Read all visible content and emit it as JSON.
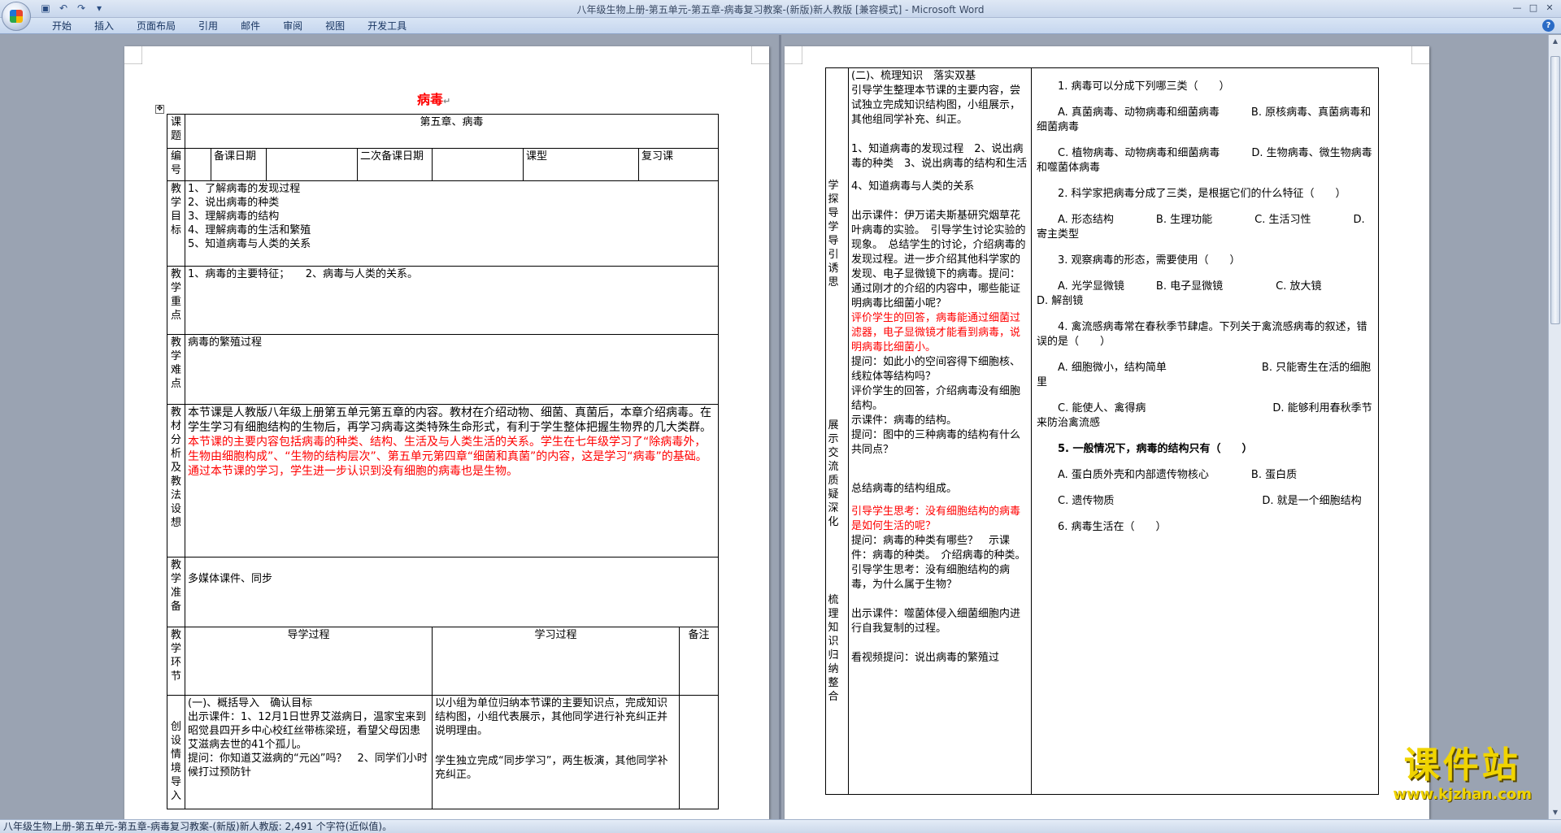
{
  "window": {
    "title": "八年级生物上册-第五单元-第五章-病毒复习教案-(新版)新人教版 [兼容模式] - Microsoft Word"
  },
  "ribbon": {
    "tabs": [
      "开始",
      "插入",
      "页面布局",
      "引用",
      "邮件",
      "审阅",
      "视图",
      "开发工具"
    ]
  },
  "status": {
    "text": "八年级生物上册-第五单元-第五章-病毒复习教案-(新版)新人教版: 2,491 个字符(近似值)。"
  },
  "page1": {
    "title": "病毒",
    "rows": {
      "topic_label": "课题",
      "topic_value": "第五章、病毒",
      "num_label": "编号",
      "prep_date_label": "备课日期",
      "second_prep_label": "二次备课日期",
      "class_type_label": "课型",
      "class_type_value": "复习课",
      "goals_label": "教学目标",
      "goals": [
        "1、了解病毒的发现过程",
        "2、说出病毒的种类",
        "3、理解病毒的结构",
        "4、理解病毒的生活和繁殖",
        "5、知道病毒与人类的关系"
      ],
      "focus_label": "教学重点",
      "focus_value": "1、病毒的主要特征；　　2、病毒与人类的关系。",
      "difficulty_label": "教学难点",
      "difficulty_value": "病毒的繁殖过程",
      "analysis_label": "教材分析及教法设想",
      "analysis_black": "本节课是人教版八年级上册第五单元第五章的内容。教材在介绍动物、细菌、真菌后，本章介绍病毒。在学生学习有细胞结构的生物后，再学习病毒这类特殊生命形式，有利于学生整体把握生物界的几大类群。",
      "analysis_red": "本节课的主要内容包括病毒的种类、结构、生活及与人类生活的关系。学生在七年级学习了“除病毒外，生物由细胞构成”、“生物的结构层次”、第五单元第四章“细菌和真菌”的内容，这是学习“病毒”的基础。通过本节课的学习，学生进一步认识到没有细胞的病毒也是生物。",
      "prep_label": "教学准备",
      "prep_value": "多媒体课件、同步",
      "link_label": "教学环节",
      "guide_header": "导学过程",
      "study_header": "学习过程",
      "note_header": "备注",
      "create_label": "创设情境导入",
      "create_guide": [
        "(一)、概括导入　确认目标",
        "出示课件：1、12月1日世界艾滋病日，温家宝来到昭觉县四开乡中心校红丝带栋梁班，看望父母因患艾滋病去世的41个孤儿。",
        "提问：你知道艾滋病的“元凶”吗？　2、同学们小时候打过预防针"
      ],
      "create_study": [
        "以小组为单位归纳本节课的主要知识点，完成知识结构图，小组代表展示，其他同学进行补充纠正并说明理由。",
        "学生独立完成“同步学习”，两生板演，其他同学补充纠正。"
      ]
    }
  },
  "page2": {
    "col1_labels": {
      "explore": "学探导学导引诱思",
      "show": "展示交流质疑深化",
      "summary": "梳理知识归纳整合"
    },
    "col2": {
      "heading": "(二)、梳理知识　落实双基",
      "p1": "引导学生整理本节课的主要内容，尝试独立完成知识结构图，小组展示，其他组同学补充、纠正。",
      "p2": "1、知道病毒的发现过程　2、说出病毒的种类　3、说出病毒的结构和生活",
      "p3": "4、知道病毒与人类的关系",
      "p4": "出示课件：伊万诺夫斯基研究烟草花叶病毒的实验。　引导学生讨论实验的现象。　总结学生的讨论，介绍病毒的发现过程。进一步介绍其他科学家的发现、电子显微镜下的病毒。提问：通过刚才的介绍的内容中，哪些能证明病毒比细菌小呢？",
      "p4_red": "评价学生的回答，病毒能通过细菌过滤器，电子显微镜才能看到病毒，说明病毒比细菌小。",
      "p5": "提问：如此小的空间容得下细胞核、线粒体等结构吗？",
      "p6": "评价学生的回答，介绍病毒没有细胞结构。",
      "p7": "示课件：病毒的结构。",
      "p8": "提问：图中的三种病毒的结构有什么共同点？",
      "p9": "总结病毒的结构组成。",
      "p10_red": "引导学生思考：没有细胞结构的病毒是如何生活的呢？",
      "p10": "提问：病毒的种类有哪些？　示课件：病毒的种类。　介绍病毒的种类。引导学生思考：没有细胞结构的病毒，为什么属于生物？",
      "p11": "出示课件：噬菌体侵入细菌细胞内进行自我复制的过程。",
      "p12": "看视频提问：说出病毒的繁殖过"
    },
    "col3": {
      "q1": "1. 病毒可以分成下列哪三类（　　）",
      "q1a": "A. 真菌病毒、动物病毒和细菌病毒　　　B. 原核病毒、真菌病毒和细菌病毒",
      "q1c": "C. 植物病毒、动物病毒和细菌病毒　　　D. 生物病毒、微生物病毒和噬菌体病毒",
      "q2": "2. 科学家把病毒分成了三类，是根据它们的什么特征（　　）",
      "q2a": "A. 形态结构　　　　B. 生理功能　　　　C. 生活习性　　　　D. 寄主类型",
      "q3": "3. 观察病毒的形态，需要使用（　　）",
      "q3a": "A. 光学显微镜　　　B. 电子显微镜　　　　　C. 放大镜　　　　　D. 解剖镜",
      "q4": "4. 禽流感病毒常在春秋季节肆虐。下列关于禽流感病毒的叙述，错误的是（　　）",
      "q4a": "A. 细胞微小，结构简单　　　　　　　　　B. 只能寄生在活的细胞里",
      "q4c": "C. 能使人、禽得病　　　　　　　　　　　　D. 能够利用春秋季节来防治禽流感",
      "q5": "5. 一般情况下，病毒的结构只有（　　）",
      "q5a": "A. 蛋白质外壳和内部遗传物核心　　　　B. 蛋白质",
      "q5c": "C. 遗传物质　　　　　　　　　　　　　　D. 就是一个细胞结构",
      "q6": "6. 病毒生活在（　　）"
    }
  },
  "watermark": {
    "text": "课件站",
    "url": "www.kjzhan.com"
  }
}
